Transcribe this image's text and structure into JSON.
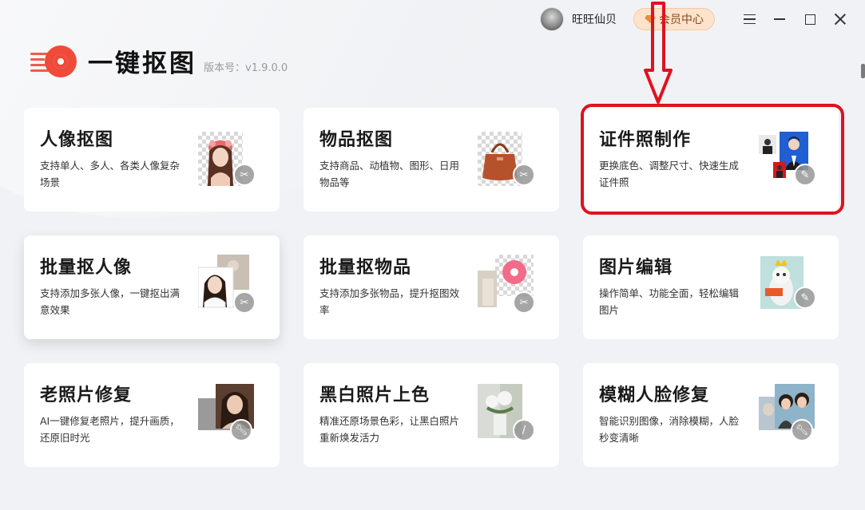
{
  "titlebar": {
    "username": "旺旺仙贝",
    "vip_label": "会员中心"
  },
  "app": {
    "name": "一键抠图",
    "version": "版本号：v1.9.0.0"
  },
  "cards": [
    {
      "title": "人像抠图",
      "desc": "支持单人、多人、各类人像复杂场景",
      "tool": "scissors-icon"
    },
    {
      "title": "物品抠图",
      "desc": "支持商品、动植物、图形、日用物品等",
      "tool": "scissors-icon"
    },
    {
      "title": "证件照制作",
      "desc": "更换底色、调整尺寸、快速生成证件照",
      "tool": "pencil-icon"
    },
    {
      "title": "批量抠人像",
      "desc": "支持添加多张人像，一键抠出满意效果",
      "tool": "scissors-icon"
    },
    {
      "title": "批量抠物品",
      "desc": "支持添加多张物品，提升抠图效率",
      "tool": "scissors-icon"
    },
    {
      "title": "图片编辑",
      "desc": "操作简单、功能全面，轻松编辑图片",
      "tool": "pencil-icon"
    },
    {
      "title": "老照片修复",
      "desc": "AI一键修复老照片，提升画质，还原旧时光",
      "tool": "wrench-icon"
    },
    {
      "title": "黑白照片上色",
      "desc": "精准还原场景色彩，让黑白照片重新焕发活力",
      "tool": "brush-icon"
    },
    {
      "title": "模糊人脸修复",
      "desc": "智能识别图像，消除模糊，人脸秒变清晰",
      "tool": "wrench-icon"
    }
  ],
  "highlight_color": "#e0121e",
  "accent_color": "#f04a3a"
}
